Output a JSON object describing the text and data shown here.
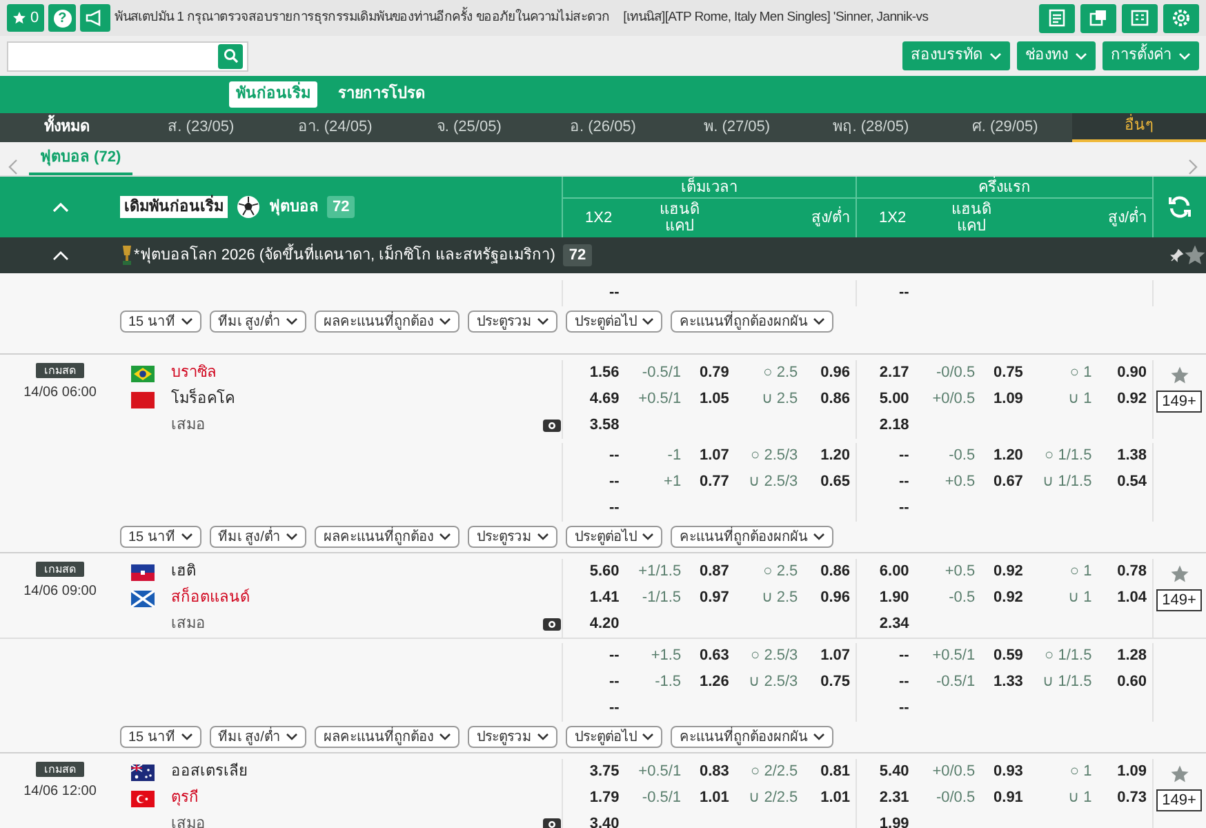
{
  "top_bar": {
    "favorites_count": "0",
    "help": "?",
    "ticker": "พันสเตปมัน 1 กรุณาตรวจสอบรายการธุรกรรมเดิมพันของท่านอีกครั้ง ขออภัยในความไม่สะดวก",
    "ticker_next": "[เทนนิส][ATP Rome, Italy Men Singles] 'Sinner, Jannik-vs"
  },
  "toolbar": {
    "buttons": [
      "สองบรรทัด",
      "ช่องทง",
      "การตั้งค่า"
    ]
  },
  "main_tabs": [
    {
      "label": "พันก่อนเริ่ม",
      "selected": true
    },
    {
      "label": "รายการโปรด",
      "selected": false
    }
  ],
  "date_tabs": [
    {
      "label": "ทั้งหมด",
      "selected": false
    },
    {
      "label": "ส. (23/05)",
      "selected": false
    },
    {
      "label": "อา. (24/05)",
      "selected": false
    },
    {
      "label": "จ. (25/05)",
      "selected": false
    },
    {
      "label": "อ. (26/05)",
      "selected": false
    },
    {
      "label": "พ. (27/05)",
      "selected": false
    },
    {
      "label": "พฤ. (28/05)",
      "selected": false
    },
    {
      "label": "ศ. (29/05)",
      "selected": false
    },
    {
      "label": "อื่นๆ",
      "selected": true
    }
  ],
  "sport_tabs": [
    {
      "label": "ฟุตบอล (72)",
      "selected": true
    }
  ],
  "header": {
    "market_label": "เดิมพันก่อนเริ่ม",
    "sport": "ฟุตบอล",
    "count": "72",
    "groups": [
      {
        "title": "เต็มเวลา",
        "columns": [
          "1X2",
          "แฮนดิ แคป",
          "สูง/ต่ำ"
        ]
      },
      {
        "title": "ครึ่งแรก",
        "columns": [
          "1X2",
          "แฮนดิ แคป",
          "สูง/ต่ำ"
        ]
      }
    ]
  },
  "league": {
    "name": "*ฟุตบอลโลก 2026 (จัดขึ้นที่แคนาดา, เม็กซิโก และสหรัฐอเมริกา)",
    "count": "72"
  },
  "previous_match_tail": {
    "rows": [
      {
        "ft": [
          "--"
        ],
        "h1": [
          "--"
        ]
      }
    ],
    "filters": [
      "15 นาที",
      "ทีมเ สูง/ต่ำ",
      "ผลคะแนนที่ถูกต้อง",
      "ประตูรวม",
      "ประตูต่อไป",
      "คะแนนที่ถูกต้องผกผัน"
    ]
  },
  "matches": [
    {
      "badge": "เกมสด",
      "time": "14/06 06:00",
      "teams": [
        {
          "name": "บราซิล",
          "favorite": true
        },
        {
          "name": "โมร็อคโค",
          "favorite": false
        }
      ],
      "draw_label": "เสมอ",
      "more": "149+",
      "main_rows": [
        {
          "ft": [
            "1.56",
            "-0.5/1",
            "0.79",
            "○ 2.5",
            "0.96"
          ],
          "h1": [
            "2.17",
            "-0/0.5",
            "0.75",
            "○ 1",
            "0.90"
          ]
        },
        {
          "ft": [
            "4.69",
            "+0.5/1",
            "1.05",
            "∪ 2.5",
            "0.86"
          ],
          "h1": [
            "5.00",
            "+0/0.5",
            "1.09",
            "∪ 1",
            "0.92"
          ]
        },
        {
          "ft": [
            "3.58"
          ],
          "h1": [
            "2.18"
          ]
        }
      ],
      "extra_rows": [
        {
          "ft": [
            "--",
            "-1",
            "1.07",
            "○ 2.5/3",
            "1.20"
          ],
          "h1": [
            "--",
            "-0.5",
            "1.20",
            "○ 1/1.5",
            "1.38"
          ]
        },
        {
          "ft": [
            "--",
            "+1",
            "0.77",
            "∪ 2.5/3",
            "0.65"
          ],
          "h1": [
            "--",
            "+0.5",
            "0.67",
            "∪ 1/1.5",
            "0.54"
          ]
        },
        {
          "ft": [
            "--"
          ],
          "h1": [
            "--"
          ]
        }
      ],
      "filters": [
        "15 นาที",
        "ทีมเ สูง/ต่ำ",
        "ผลคะแนนที่ถูกต้อง",
        "ประตูรวม",
        "ประตูต่อไป",
        "คะแนนที่ถูกต้องผกผัน"
      ]
    },
    {
      "badge": "เกมสด",
      "time": "14/06 09:00",
      "teams": [
        {
          "name": "เฮติ",
          "favorite": false
        },
        {
          "name": "สก็อตแลนด์",
          "favorite": true
        }
      ],
      "draw_label": "เสมอ",
      "more": "149+",
      "main_rows": [
        {
          "ft": [
            "5.60",
            "+1/1.5",
            "0.87",
            "○ 2.5",
            "0.86"
          ],
          "h1": [
            "6.00",
            "+0.5",
            "0.92",
            "○ 1",
            "0.78"
          ]
        },
        {
          "ft": [
            "1.41",
            "-1/1.5",
            "0.97",
            "∪ 2.5",
            "0.96"
          ],
          "h1": [
            "1.90",
            "-0.5",
            "0.92",
            "∪ 1",
            "1.04"
          ]
        },
        {
          "ft": [
            "4.20"
          ],
          "h1": [
            "2.34"
          ]
        }
      ],
      "extra_rows": [
        {
          "ft": [
            "--",
            "+1.5",
            "0.63",
            "○ 2.5/3",
            "1.07"
          ],
          "h1": [
            "--",
            "+0.5/1",
            "0.59",
            "○ 1/1.5",
            "1.28"
          ]
        },
        {
          "ft": [
            "--",
            "-1.5",
            "1.26",
            "∪ 2.5/3",
            "0.75"
          ],
          "h1": [
            "--",
            "-0.5/1",
            "1.33",
            "∪ 1/1.5",
            "0.60"
          ]
        },
        {
          "ft": [
            "--"
          ],
          "h1": [
            "--"
          ]
        }
      ],
      "filters": [
        "15 นาที",
        "ทีมเ สูง/ต่ำ",
        "ผลคะแนนที่ถูกต้อง",
        "ประตูรวม",
        "ประตูต่อไป",
        "คะแนนที่ถูกต้องผกผัน"
      ]
    },
    {
      "badge": "เกมสด",
      "time": "14/06 12:00",
      "teams": [
        {
          "name": "ออสเตรเลีย",
          "favorite": false
        },
        {
          "name": "ตุรกี",
          "favorite": true
        }
      ],
      "draw_label": "เสมอ",
      "more": "149+",
      "main_rows": [
        {
          "ft": [
            "3.75",
            "+0.5/1",
            "0.83",
            "○ 2/2.5",
            "0.81"
          ],
          "h1": [
            "5.40",
            "+0/0.5",
            "0.93",
            "○ 1",
            "1.09"
          ]
        },
        {
          "ft": [
            "1.79",
            "-0.5/1",
            "1.01",
            "∪ 2/2.5",
            "1.01"
          ],
          "h1": [
            "2.31",
            "-0/0.5",
            "0.91",
            "∪ 1",
            "0.73"
          ]
        },
        {
          "ft": [
            "3.40"
          ],
          "h1": [
            "1.99"
          ]
        }
      ]
    }
  ]
}
